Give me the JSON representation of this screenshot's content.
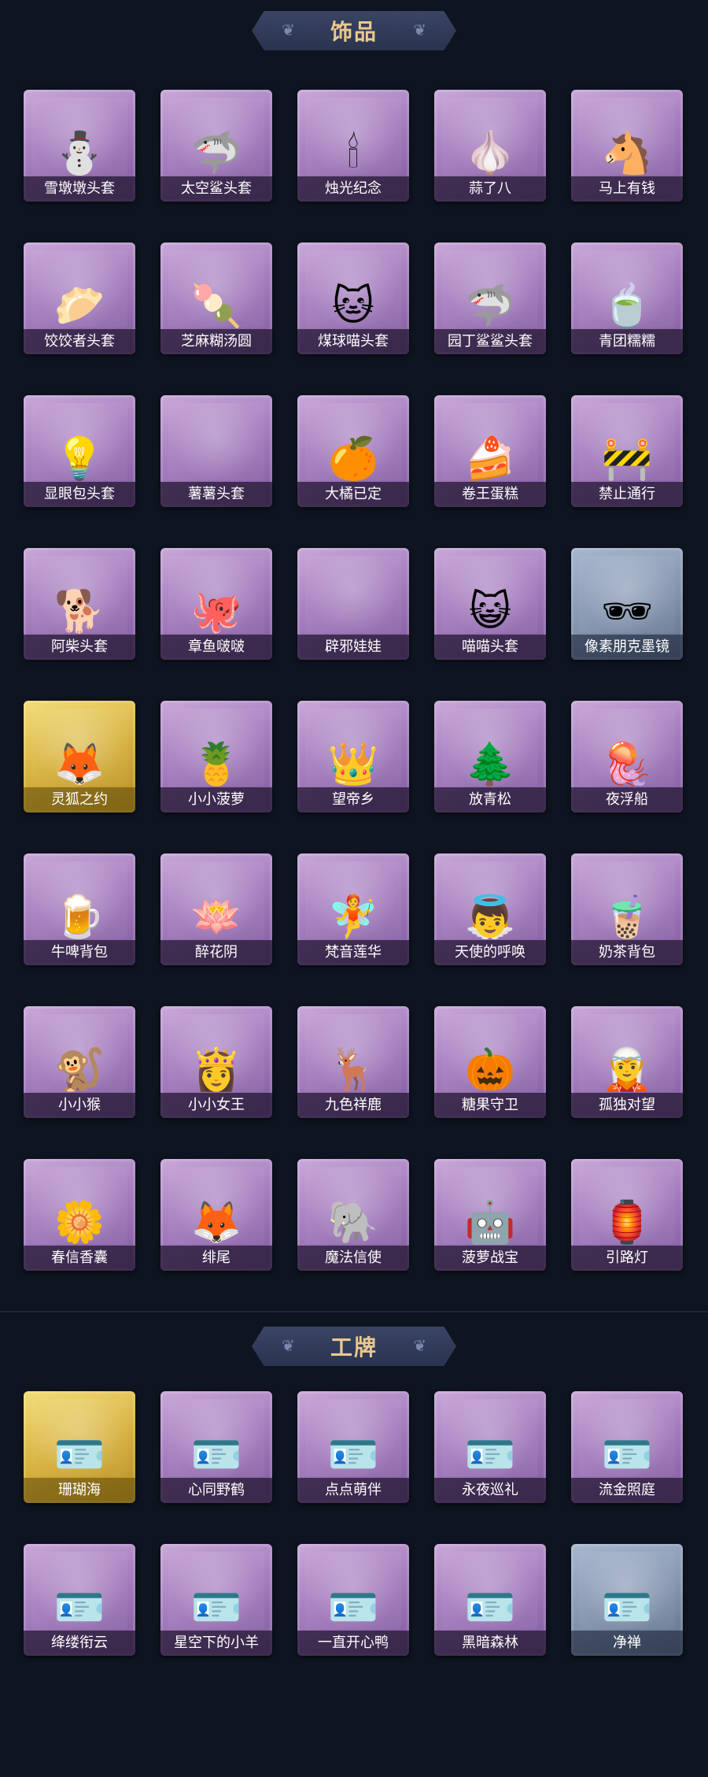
{
  "sections": [
    {
      "title": "饰品",
      "items": [
        {
          "label": "雪墩墩头套",
          "icon": "snowman-head-icon",
          "glyph": "⛄",
          "tone": "purple"
        },
        {
          "label": "太空鲨头套",
          "icon": "shark-head-icon",
          "glyph": "🦈",
          "tone": "purple"
        },
        {
          "label": "烛光纪念",
          "icon": "candle-icon",
          "glyph": "🕯",
          "tone": "purple"
        },
        {
          "label": "蒜了八",
          "icon": "garlic-icon",
          "glyph": "🧄",
          "tone": "purple"
        },
        {
          "label": "马上有钱",
          "icon": "horse-head-icon",
          "glyph": "🐴",
          "tone": "purple"
        },
        {
          "label": "饺饺者头套",
          "icon": "dumpling-head-icon",
          "glyph": "🥟",
          "tone": "purple"
        },
        {
          "label": "芝麻糊汤圆",
          "icon": "rice-ball-icon",
          "glyph": "🍡",
          "tone": "purple"
        },
        {
          "label": "煤球喵头套",
          "icon": "cat-head-icon",
          "glyph": "🐱",
          "tone": "purple"
        },
        {
          "label": "园丁鲨鲨头套",
          "icon": "gardener-shark-icon",
          "glyph": "🦈",
          "tone": "purple"
        },
        {
          "label": "青团糯糯",
          "icon": "green-rice-ball-icon",
          "glyph": "🍵",
          "tone": "purple"
        },
        {
          "label": "显眼包头套",
          "icon": "lightbulb-head-icon",
          "glyph": "💡",
          "tone": "purple"
        },
        {
          "label": "薯薯头套",
          "icon": "blank-item-icon",
          "glyph": "",
          "tone": "purple"
        },
        {
          "label": "大橘已定",
          "icon": "orange-slice-icon",
          "glyph": "🍊",
          "tone": "purple"
        },
        {
          "label": "卷王蛋糕",
          "icon": "roll-cake-icon",
          "glyph": "🍰",
          "tone": "purple"
        },
        {
          "label": "禁止通行",
          "icon": "traffic-cone-icon",
          "glyph": "🚧",
          "tone": "purple"
        },
        {
          "label": "阿柴头套",
          "icon": "shiba-head-icon",
          "glyph": "🐕",
          "tone": "purple"
        },
        {
          "label": "章鱼啵啵",
          "icon": "octopus-icon",
          "glyph": "🐙",
          "tone": "purple"
        },
        {
          "label": "辟邪娃娃",
          "icon": "blank-item-icon",
          "glyph": "",
          "tone": "purple"
        },
        {
          "label": "喵喵头套",
          "icon": "tabby-cat-icon",
          "glyph": "😺",
          "tone": "purple"
        },
        {
          "label": "像素朋克墨镜",
          "icon": "pixel-sunglasses-icon",
          "glyph": "🕶",
          "tone": "grey"
        },
        {
          "label": "灵狐之约",
          "icon": "fox-spirit-icon",
          "glyph": "🦊",
          "tone": "gold"
        },
        {
          "label": "小小菠萝",
          "icon": "pineapple-icon",
          "glyph": "🍍",
          "tone": "purple"
        },
        {
          "label": "望帝乡",
          "icon": "emperor-figure-icon",
          "glyph": "👑",
          "tone": "purple"
        },
        {
          "label": "放青松",
          "icon": "potted-pine-icon",
          "glyph": "🌲",
          "tone": "purple"
        },
        {
          "label": "夜浮船",
          "icon": "jellyfish-icon",
          "glyph": "🪼",
          "tone": "purple"
        },
        {
          "label": "牛啤背包",
          "icon": "beer-barrel-icon",
          "glyph": "🍺",
          "tone": "purple"
        },
        {
          "label": "醉花阴",
          "icon": "dreamcatcher-icon",
          "glyph": "🪷",
          "tone": "purple"
        },
        {
          "label": "梵音莲华",
          "icon": "lotus-fairy-icon",
          "glyph": "🧚",
          "tone": "purple"
        },
        {
          "label": "天使的呼唤",
          "icon": "angel-icon",
          "glyph": "👼",
          "tone": "purple"
        },
        {
          "label": "奶茶背包",
          "icon": "milk-tea-icon",
          "glyph": "🧋",
          "tone": "purple"
        },
        {
          "label": "小小猴",
          "icon": "monkey-icon",
          "glyph": "🐒",
          "tone": "purple"
        },
        {
          "label": "小小女王",
          "icon": "queen-figure-icon",
          "glyph": "👸",
          "tone": "purple"
        },
        {
          "label": "九色祥鹿",
          "icon": "deer-icon",
          "glyph": "🦌",
          "tone": "purple"
        },
        {
          "label": "糖果守卫",
          "icon": "pumpkin-guard-icon",
          "glyph": "🎃",
          "tone": "purple"
        },
        {
          "label": "孤独对望",
          "icon": "lonely-doll-icon",
          "glyph": "🧝",
          "tone": "purple"
        },
        {
          "label": "春信香囊",
          "icon": "sachet-icon",
          "glyph": "🌼",
          "tone": "purple"
        },
        {
          "label": "绯尾",
          "icon": "red-fox-icon",
          "glyph": "🦊",
          "tone": "purple"
        },
        {
          "label": "魔法信使",
          "icon": "elephant-icon",
          "glyph": "🐘",
          "tone": "purple"
        },
        {
          "label": "菠萝战宝",
          "icon": "pineapple-robot-icon",
          "glyph": "🤖",
          "tone": "purple"
        },
        {
          "label": "引路灯",
          "icon": "lantern-icon",
          "glyph": "🏮",
          "tone": "purple"
        }
      ]
    },
    {
      "title": "工牌",
      "items": [
        {
          "label": "珊瑚海",
          "icon": "ice-frame-card-icon",
          "glyph": "🪪",
          "tone": "gold"
        },
        {
          "label": "心同野鹤",
          "icon": "golden-card-icon",
          "glyph": "🪪",
          "tone": "purple"
        },
        {
          "label": "点点萌伴",
          "icon": "meadow-card-icon",
          "glyph": "🪪",
          "tone": "purple"
        },
        {
          "label": "永夜巡礼",
          "icon": "night-card-icon",
          "glyph": "🪪",
          "tone": "purple"
        },
        {
          "label": "流金照庭",
          "icon": "golden-palace-card-icon",
          "glyph": "🪪",
          "tone": "purple"
        },
        {
          "label": "绛缕衔云",
          "icon": "crimson-card-icon",
          "glyph": "🪪",
          "tone": "purple"
        },
        {
          "label": "星空下的小羊",
          "icon": "sheep-card-icon",
          "glyph": "🪪",
          "tone": "purple"
        },
        {
          "label": "一直开心鸭",
          "icon": "duck-card-icon",
          "glyph": "🪪",
          "tone": "purple"
        },
        {
          "label": "黑暗森林",
          "icon": "galaxy-card-icon",
          "glyph": "🪪",
          "tone": "purple"
        },
        {
          "label": "净禅",
          "icon": "silhouette-card-icon",
          "glyph": "🪪",
          "tone": "grey"
        }
      ]
    }
  ]
}
